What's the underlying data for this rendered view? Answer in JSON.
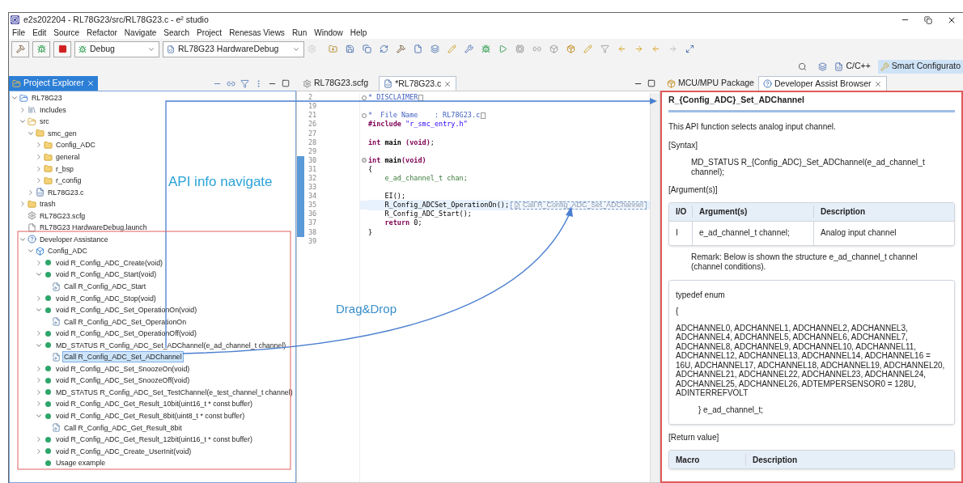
{
  "window": {
    "title": "e2s202204 - RL78G23/src/RL78G23.c - e² studio"
  },
  "menu": [
    "File",
    "Edit",
    "Source",
    "Refactor",
    "Navigate",
    "Search",
    "Project",
    "Renesas Views",
    "Run",
    "Window",
    "Help"
  ],
  "toolbar": {
    "build_config": "Debug",
    "launch_config": "RL78G23 HardwareDebug"
  },
  "perspectives": [
    {
      "label": "C/C++",
      "selected": false
    },
    {
      "label": "Smart Configurato",
      "selected": true
    }
  ],
  "explorer": {
    "tabs": [
      {
        "label": "Project Explorer",
        "selected": true
      }
    ],
    "tree": [
      {
        "label": "RL78G23",
        "kind": "project",
        "expanded": true,
        "selected": false,
        "children": [
          {
            "label": "Includes",
            "kind": "includes",
            "expanded": false,
            "selected": false
          },
          {
            "label": "src",
            "kind": "srcfolder",
            "expanded": true,
            "selected": false,
            "children": [
              {
                "label": "smc_gen",
                "kind": "folder",
                "expanded": true,
                "selected": false,
                "children": [
                  {
                    "label": "Config_ADC",
                    "kind": "folder",
                    "expanded": false,
                    "selected": false
                  },
                  {
                    "label": "general",
                    "kind": "folder",
                    "expanded": false,
                    "selected": false
                  },
                  {
                    "label": "r_bsp",
                    "kind": "folder",
                    "expanded": false,
                    "selected": false
                  },
                  {
                    "label": "r_config",
                    "kind": "folder",
                    "expanded": false,
                    "selected": false
                  }
                ]
              },
              {
                "label": "RL78G23.c",
                "kind": "cfile",
                "expanded": false,
                "selected": false
              }
            ]
          },
          {
            "label": "trash",
            "kind": "folder",
            "expanded": false,
            "selected": false
          },
          {
            "label": "RL78G23.scfg",
            "kind": "config",
            "selected": false
          },
          {
            "label": "RL78G23 HardwareDebug.launch",
            "kind": "file",
            "selected": false
          },
          {
            "label": "Developer Assistance",
            "kind": "help",
            "expanded": true,
            "selected": false,
            "children": [
              {
                "label": "Config_ADC",
                "kind": "component",
                "expanded": true,
                "selected": false,
                "children": [
                  {
                    "label": "void R_Config_ADC_Create(void)",
                    "kind": "function",
                    "expanded": false,
                    "selected": false
                  },
                  {
                    "label": "void R_Config_ADC_Start(void)",
                    "kind": "function",
                    "expanded": true,
                    "selected": false,
                    "children": [
                      {
                        "label": "Call R_Config_ADC_Start",
                        "kind": "call",
                        "selected": false
                      }
                    ]
                  },
                  {
                    "label": "void R_Config_ADC_Stop(void)",
                    "kind": "function",
                    "expanded": false,
                    "selected": false
                  },
                  {
                    "label": "void R_Config_ADC_Set_OperationOn(void)",
                    "kind": "function",
                    "expanded": true,
                    "selected": false,
                    "children": [
                      {
                        "label": "Call R_Config_ADC_Set_OperationOn",
                        "kind": "call",
                        "selected": false
                      }
                    ]
                  },
                  {
                    "label": "void R_Config_ADC_Set_OperationOff(void)",
                    "kind": "function",
                    "expanded": false,
                    "selected": false
                  },
                  {
                    "label": "MD_STATUS R_Config_ADC_Set_ADChannel(e_ad_channel_t channel)",
                    "kind": "function",
                    "expanded": true,
                    "selected": false,
                    "children": [
                      {
                        "label": "Call R_Config_ADC_Set_ADChannel",
                        "kind": "call",
                        "selected": true
                      }
                    ]
                  },
                  {
                    "label": "void R_Config_ADC_Set_SnoozeOn(void)",
                    "kind": "function",
                    "expanded": false,
                    "selected": false
                  },
                  {
                    "label": "void R_Config_ADC_Set_SnoozeOff(void)",
                    "kind": "function",
                    "expanded": false,
                    "selected": false
                  },
                  {
                    "label": "MD_STATUS R_Config_ADC_Set_TestChannel(e_test_channel_t channel)",
                    "kind": "function",
                    "expanded": false,
                    "selected": false
                  },
                  {
                    "label": "void R_Config_ADC_Get_Result_10bit(uint16_t * const buffer)",
                    "kind": "function",
                    "expanded": false,
                    "selected": false
                  },
                  {
                    "label": "void R_Config_ADC_Get_Result_8bit(uint8_t * const buffer)",
                    "kind": "function",
                    "expanded": true,
                    "selected": false,
                    "children": [
                      {
                        "label": "Call R_Config_ADC_Get_Result_8bit",
                        "kind": "call",
                        "selected": false
                      }
                    ]
                  },
                  {
                    "label": "void R_Config_ADC_Get_Result_12bit(uint16_t * const buffer)",
                    "kind": "function",
                    "expanded": false,
                    "selected": false
                  },
                  {
                    "label": "void R_Config_ADC_Create_UserInit(void)",
                    "kind": "function",
                    "expanded": false,
                    "selected": false
                  },
                  {
                    "label": "Usage example",
                    "kind": "example",
                    "selected": false
                  }
                ]
              }
            ]
          }
        ]
      }
    ]
  },
  "editor": {
    "tabs": [
      {
        "label": "RL78G23.scfg",
        "kind": "config",
        "selected": false
      },
      {
        "label": "*RL78G23.c",
        "kind": "cfile",
        "selected": true
      }
    ],
    "lines": [
      {
        "n": "2",
        "folded": true,
        "changed": false,
        "current": false,
        "segs": [
          {
            "t": "* DISCLAIMER",
            "kind": "comment"
          }
        ]
      },
      {
        "n": "19",
        "changed": false,
        "current": false
      },
      {
        "n": "21",
        "folded": true,
        "changed": false,
        "current": false,
        "segs": [
          {
            "t": "*  File Name    : RL78G23.c",
            "kind": "comment"
          }
        ]
      },
      {
        "n": "26",
        "changed": false,
        "current": false,
        "segs": [
          {
            "t": "#include",
            "kind": "keyword"
          },
          {
            "t": " \"r_smc_entry.h\"",
            "kind": "string"
          }
        ]
      },
      {
        "n": "27",
        "changed": false,
        "current": false
      },
      {
        "n": "28",
        "changed": false,
        "current": false,
        "segs": [
          {
            "t": "int",
            "kind": "keyword"
          },
          {
            "t": " main ",
            "kind": "function"
          },
          {
            "t": "(void)",
            "kind": "keyword"
          },
          {
            "t": ";",
            "kind": "plain"
          }
        ]
      },
      {
        "n": "29",
        "changed": false,
        "current": false
      },
      {
        "n": "30",
        "folded": false,
        "changed": true,
        "current": false,
        "segs": [
          {
            "t": "int",
            "kind": "keyword"
          },
          {
            "t": " main",
            "kind": "function"
          },
          {
            "t": "(void)",
            "kind": "keyword"
          }
        ]
      },
      {
        "n": "31",
        "changed": true,
        "current": false,
        "segs": [
          {
            "t": "{",
            "kind": "plain"
          }
        ]
      },
      {
        "n": "32",
        "changed": true,
        "current": false,
        "segs": [
          {
            "t": "    e_ad_channel_t chan;",
            "kind": "type"
          }
        ]
      },
      {
        "n": "33",
        "changed": true,
        "current": false
      },
      {
        "n": "34",
        "changed": true,
        "current": false,
        "segs": [
          {
            "t": "    EI();",
            "kind": "plain"
          }
        ]
      },
      {
        "n": "35",
        "changed": true,
        "current": true,
        "segs": [
          {
            "t": "    R_Config_ADCSet_OperationOn();",
            "kind": "plain"
          }
        ],
        "drop_hint": "Call R_Config_ADC_Set_ADChannel"
      },
      {
        "n": "36",
        "changed": true,
        "current": false,
        "segs": [
          {
            "t": "    R_Config_ADC_Start();",
            "kind": "plain"
          }
        ]
      },
      {
        "n": "37",
        "changed": true,
        "current": false,
        "segs": [
          {
            "t": "    return",
            "kind": "keyword"
          },
          {
            "t": " 0;",
            "kind": "plain"
          }
        ]
      },
      {
        "n": "38",
        "changed": true,
        "current": false,
        "segs": [
          {
            "t": "}",
            "kind": "plain"
          }
        ]
      },
      {
        "n": "39",
        "changed": false,
        "current": false
      }
    ]
  },
  "browser": {
    "tabs": [
      {
        "label": "MCU/MPU Package",
        "kind": "package",
        "selected": false
      },
      {
        "label": "Developer Assist Browser",
        "kind": "help",
        "selected": true
      }
    ],
    "title": "R_{Config_ADC}_Set_ADChannel",
    "blocks": [
      {
        "kind": "paragraph",
        "text": "This API function selects analog input channel."
      },
      {
        "kind": "label",
        "text": "[Syntax]"
      },
      {
        "kind": "indent",
        "text": "MD_STATUS R_{Config_ADC}_Set_ADChannel(e_ad_channel_t channel);"
      },
      {
        "kind": "label",
        "text": "[Argument(s)]"
      },
      {
        "kind": "table",
        "columns": [
          "I/O",
          "Argument(s)",
          "Description"
        ],
        "rows": [
          [
            "I",
            "e_ad_channel_t channel;",
            "Analog input channel"
          ]
        ]
      },
      {
        "kind": "indent",
        "text": "Remark: Below is shown the structure e_ad_channel_t channel (channel conditions)."
      },
      {
        "kind": "code",
        "lines": [
          "typedef enum",
          "{",
          "ADCHANNEL0, ADCHANNEL1, ADCHANNEL2, ADCHANNEL3, ADCHANNEL4, ADCHANNEL5, ADCHANNEL6, ADCHANNEL7, ADCHANNEL8, ADCHANNEL9, ADCHANNEL10, ADCHANNEL11, ADCHANNEL12, ADCHANNEL13, ADCHANNEL14, ADCHANNEL16 = 16U, ADCHANNEL17, ADCHANNEL18, ADCHANNEL19, ADCHANNEL20, ADCHANNEL21, ADCHANNEL22, ADCHANNEL23, ADCHANNEL24, ADCHANNEL25, ADCHANNEL26, ADTEMPERSENSOR0 = 128U, ADINTERREFVOLT"
        ],
        "closing": "} e_ad_channel_t;"
      },
      {
        "kind": "label",
        "text": "[Return value]"
      },
      {
        "kind": "table",
        "columns": [
          "Macro",
          "Description"
        ]
      }
    ]
  },
  "annotations": [
    {
      "kind": "navigate",
      "text": "API info navigate"
    },
    {
      "kind": "drag",
      "text": "Drag&Drop"
    }
  ]
}
